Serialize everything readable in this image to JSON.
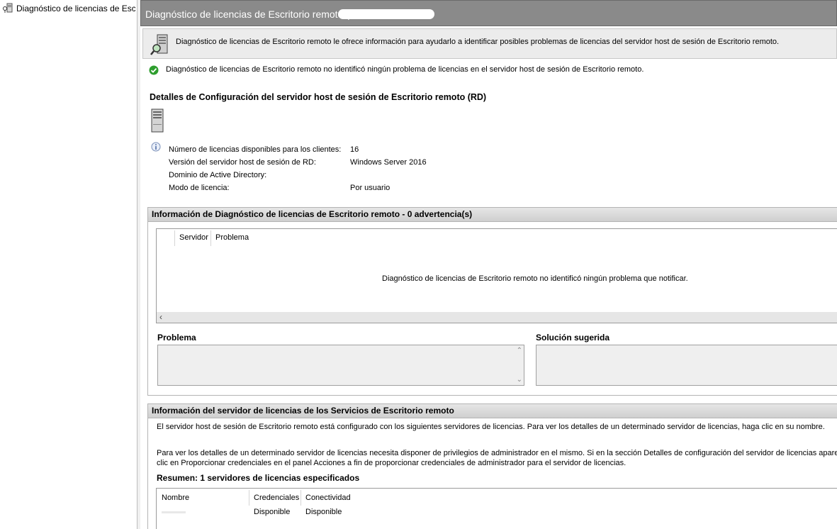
{
  "tree": {
    "item_label": "Diagnóstico de licencias de Escritorio remoto"
  },
  "title": "Diagnóstico de licencias de Escritorio remoto (",
  "intro": "Diagnóstico de licencias de Escritorio remoto le ofrece información para ayudarlo a identificar posibles problemas de licencias del servidor host de sesión de Escritorio remoto.",
  "status": "Diagnóstico de licencias de Escritorio remoto no identificó ningún problema de licencias en el servidor host de sesión de Escritorio remoto.",
  "config": {
    "heading": "Detalles de Configuración del servidor host de sesión de Escritorio remoto (RD)",
    "rows": [
      {
        "key": "Número de licencias disponibles para los clientes:",
        "value": "16"
      },
      {
        "key": "Versión del servidor host de sesión de RD:",
        "value": "Windows Server 2016"
      },
      {
        "key": "Dominio de Active Directory:",
        "value": ""
      },
      {
        "key": "Modo de licencia:",
        "value": "Por usuario"
      }
    ]
  },
  "diagnostics": {
    "heading": "Información de Diagnóstico de licencias de Escritorio remoto - 0 advertencia(s)",
    "columns": [
      "Servidor",
      "Problema"
    ],
    "empty_message": "Diagnóstico de licencias de Escritorio remoto no identificó ningún problema que notificar.",
    "problem_label": "Problema",
    "solution_label": "Solución sugerida"
  },
  "license_servers": {
    "heading": "Información del servidor de licencias de los Servicios de Escritorio remoto",
    "line1": "El servidor host de sesión de Escritorio remoto está configurado con los siguientes servidores de licencias. Para ver los detalles de un determinado servidor de licencias, haga clic en su nombre.",
    "line2": "Para ver los detalles de un determinado servidor de licencias necesita disponer de privilegios de administrador en el mismo. Si en la sección Detalles de configuración del servidor de licencias aparece Desc",
    "line3": "clic en Proporcionar credenciales en el panel Acciones a fin de proporcionar credenciales de administrador para el servidor de licencias.",
    "summary": "Resumen: 1 servidores de licencias especificados",
    "columns": [
      "Nombre",
      "Credenciales",
      "Conectividad"
    ],
    "row": {
      "credentials": "Disponible",
      "connectivity": "Disponible"
    }
  }
}
